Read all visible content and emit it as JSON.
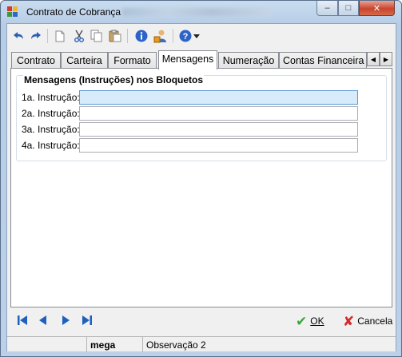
{
  "window": {
    "title": "Contrato de Cobrança",
    "controls": {
      "minimize": "–",
      "maximize": "□",
      "close": "✕"
    }
  },
  "toolbar": {
    "icons": [
      "undo-icon",
      "redo-icon",
      "new-document-icon",
      "cut-icon",
      "copy-icon",
      "paste-icon",
      "info-icon",
      "user-icon",
      "help-icon",
      "dropdown-arrow-icon"
    ]
  },
  "tabs": [
    {
      "label": "Contrato"
    },
    {
      "label": "Carteira"
    },
    {
      "label": "Formato"
    },
    {
      "label": "Mensagens",
      "active": true
    },
    {
      "label": "Numeração"
    },
    {
      "label": "Contas Financeira"
    }
  ],
  "tab_scroll": {
    "left": "◀",
    "right": "▶"
  },
  "messages_group": {
    "title": "Mensagens (Instruções) nos Bloquetos",
    "fields": [
      {
        "label": "1a. Instrução:",
        "value": ""
      },
      {
        "label": "2a. Instrução:",
        "value": ""
      },
      {
        "label": "3a. Instrução:",
        "value": ""
      },
      {
        "label": "4a. Instrução:",
        "value": ""
      }
    ]
  },
  "navigation": {
    "icons": [
      "first-record-icon",
      "previous-record-icon",
      "next-record-icon",
      "last-record-icon"
    ]
  },
  "actions": {
    "ok_label": "OK",
    "cancel_label": "Cancela"
  },
  "statusbar": {
    "user": "mega",
    "message": "Observação 2"
  },
  "colors": {
    "accent_blue": "#1f5fbf",
    "ok_green": "#3aa83a",
    "cancel_red": "#d42a2a"
  }
}
